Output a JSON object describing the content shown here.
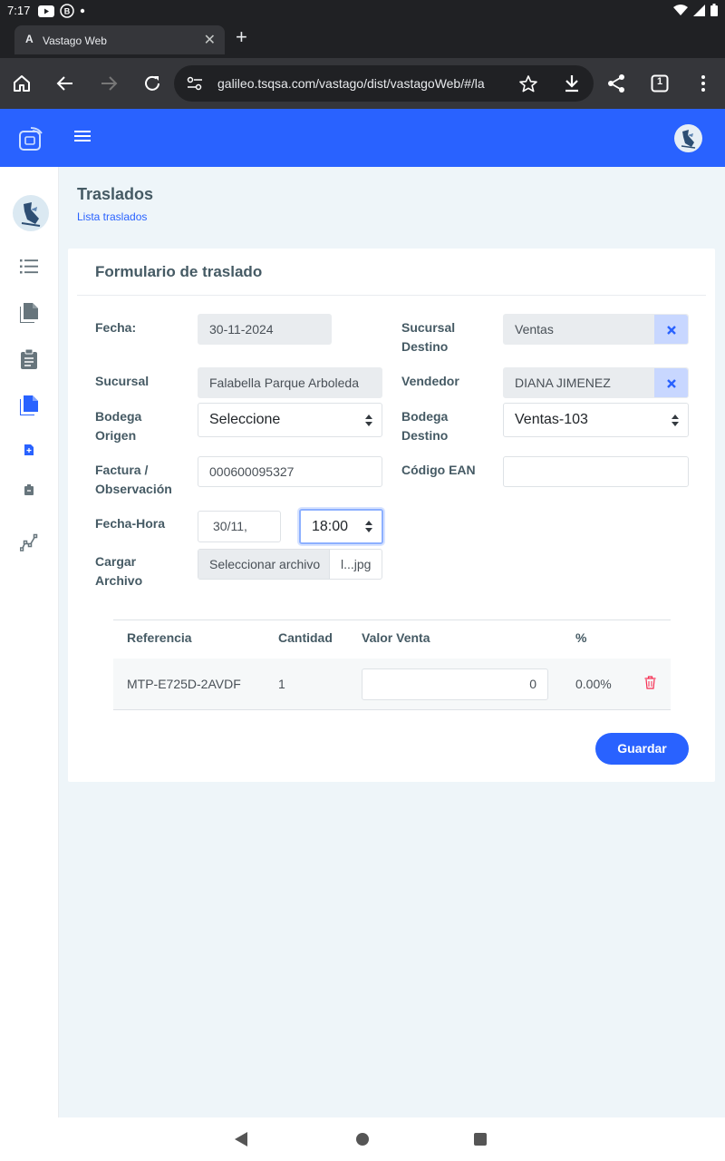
{
  "status_bar": {
    "time": "7:17"
  },
  "browser": {
    "tab_title": "Vastago Web",
    "url": "galileo.tsqsa.com/vastago/dist/vastagoWeb/#/la",
    "tab_count": "1"
  },
  "page": {
    "title": "Traslados",
    "breadcrumb": "Lista traslados",
    "form_title": "Formulario de traslado"
  },
  "form": {
    "fecha_label": "Fecha:",
    "fecha_value": "30-11-2024",
    "sucursal_destino_label": "Sucursal Destino",
    "sucursal_destino_value": "Ventas",
    "sucursal_label": "Sucursal",
    "sucursal_value": "Falabella Parque Arboleda",
    "vendedor_label": "Vendedor",
    "vendedor_value": "DIANA JIMENEZ",
    "bodega_origen_label": "Bodega Origen",
    "bodega_origen_value": "Seleccione",
    "bodega_destino_label": "Bodega Destino",
    "bodega_destino_value": "Ventas-103",
    "factura_label": "Factura / Observación",
    "factura_value": "000600095327",
    "ean_label": "Código EAN",
    "ean_value": "",
    "fecha_hora_label": "Fecha-Hora",
    "fecha_hora_date": "30/11,",
    "fecha_hora_time": "18:00",
    "cargar_label": "Cargar Archivo",
    "file_button": "Seleccionar archivo",
    "file_name": "l...jpg"
  },
  "table": {
    "headers": [
      "Referencia",
      "Cantidad",
      "Valor Venta",
      "%"
    ],
    "rows": [
      {
        "referencia": "MTP-E725D-2AVDF",
        "cantidad": "1",
        "valor_venta": "0",
        "porcentaje": "0.00%"
      }
    ]
  },
  "actions": {
    "save_label": "Guardar"
  },
  "colors": {
    "primary": "#2962ff",
    "background": "#eef5f9",
    "danger": "#f62d51"
  }
}
